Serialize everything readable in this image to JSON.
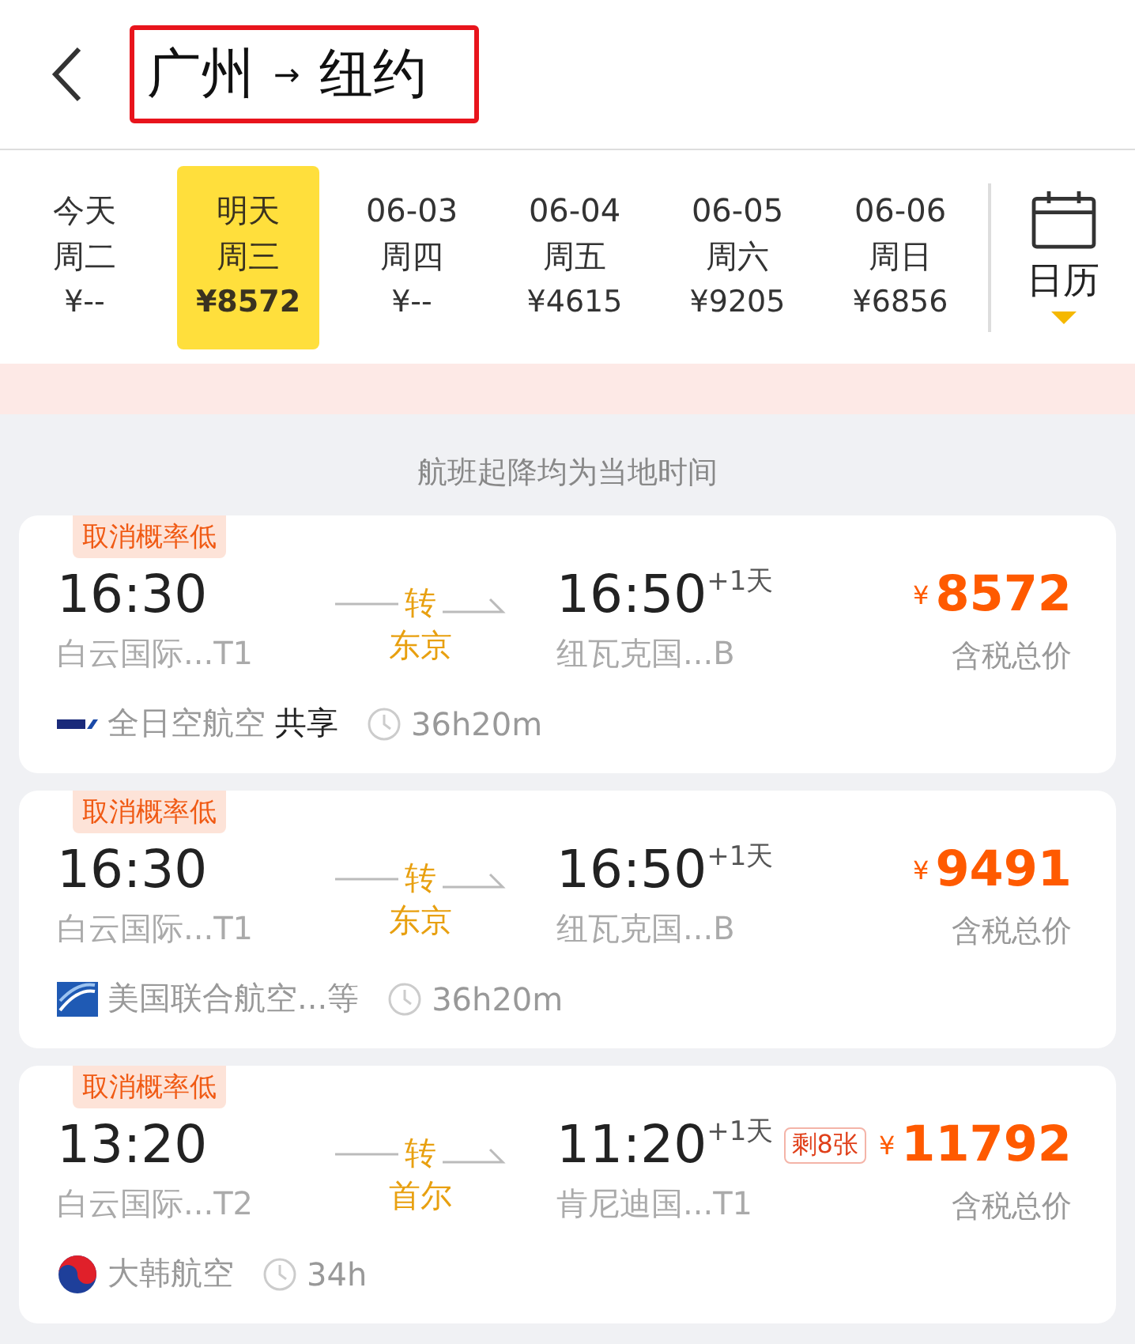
{
  "header": {
    "from": "广州",
    "arrow": "→",
    "to": "纽约"
  },
  "dates": [
    {
      "day": "今天",
      "week": "周二",
      "price": "¥--",
      "selected": false
    },
    {
      "day": "明天",
      "week": "周三",
      "price": "¥8572",
      "selected": true
    },
    {
      "day": "06-03",
      "week": "周四",
      "price": "¥--",
      "selected": false
    },
    {
      "day": "06-04",
      "week": "周五",
      "price": "¥4615",
      "selected": false
    },
    {
      "day": "06-05",
      "week": "周六",
      "price": "¥9205",
      "selected": false
    },
    {
      "day": "06-06",
      "week": "周日",
      "price": "¥6856",
      "selected": false
    }
  ],
  "calendar": {
    "label": "日历"
  },
  "notice": "航班起降均为当地时间",
  "flights": [
    {
      "tag": "取消概率低",
      "dep_time": "16:30",
      "dep_airport": "白云国际...T1",
      "transfer": "转",
      "transfer_city": "东京",
      "arr_time": "16:50",
      "arr_day": "+1天",
      "arr_airport": "纽瓦克国...B",
      "currency": "¥",
      "price": "8572",
      "price_note": "含税总价",
      "kind": "ana",
      "airline": "全日空航空",
      "shared": "共享",
      "duration": "36h20m"
    },
    {
      "tag": "取消概率低",
      "dep_time": "16:30",
      "dep_airport": "白云国际...T1",
      "transfer": "转",
      "transfer_city": "东京",
      "arr_time": "16:50",
      "arr_day": "+1天",
      "arr_airport": "纽瓦克国...B",
      "currency": "¥",
      "price": "9491",
      "price_note": "含税总价",
      "kind": "united",
      "airline": "美国联合航空...等",
      "duration": "36h20m"
    },
    {
      "tag": "取消概率低",
      "dep_time": "13:20",
      "dep_airport": "白云国际...T2",
      "transfer": "转",
      "transfer_city": "首尔",
      "arr_time": "11:20",
      "arr_day": "+1天",
      "arr_airport": "肯尼迪国...T1",
      "seats": "剩8张",
      "currency": "¥",
      "price": "11792",
      "price_note": "含税总价",
      "kind": "korean",
      "airline": "大韩航空",
      "duration": "34h"
    }
  ]
}
